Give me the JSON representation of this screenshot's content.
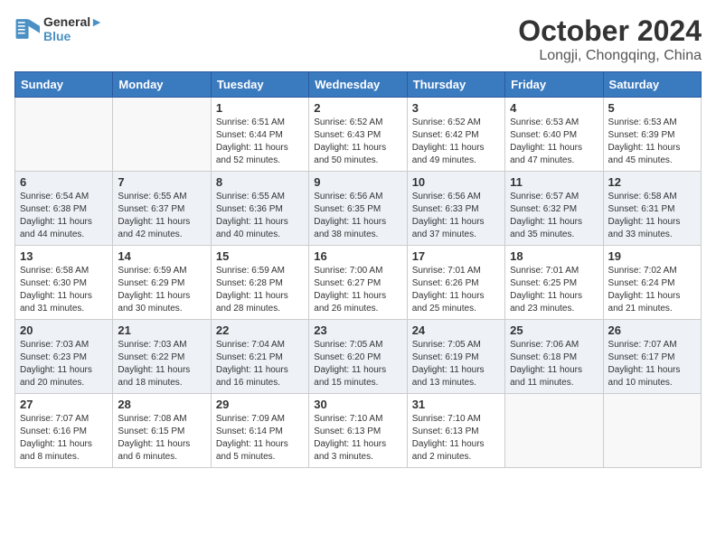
{
  "logo": {
    "line1": "General",
    "line2": "Blue"
  },
  "title": "October 2024",
  "location": "Longji, Chongqing, China",
  "weekdays": [
    "Sunday",
    "Monday",
    "Tuesday",
    "Wednesday",
    "Thursday",
    "Friday",
    "Saturday"
  ],
  "weeks": [
    [
      {
        "num": "",
        "sunrise": "",
        "sunset": "",
        "daylight": ""
      },
      {
        "num": "",
        "sunrise": "",
        "sunset": "",
        "daylight": ""
      },
      {
        "num": "1",
        "sunrise": "Sunrise: 6:51 AM",
        "sunset": "Sunset: 6:44 PM",
        "daylight": "Daylight: 11 hours and 52 minutes."
      },
      {
        "num": "2",
        "sunrise": "Sunrise: 6:52 AM",
        "sunset": "Sunset: 6:43 PM",
        "daylight": "Daylight: 11 hours and 50 minutes."
      },
      {
        "num": "3",
        "sunrise": "Sunrise: 6:52 AM",
        "sunset": "Sunset: 6:42 PM",
        "daylight": "Daylight: 11 hours and 49 minutes."
      },
      {
        "num": "4",
        "sunrise": "Sunrise: 6:53 AM",
        "sunset": "Sunset: 6:40 PM",
        "daylight": "Daylight: 11 hours and 47 minutes."
      },
      {
        "num": "5",
        "sunrise": "Sunrise: 6:53 AM",
        "sunset": "Sunset: 6:39 PM",
        "daylight": "Daylight: 11 hours and 45 minutes."
      }
    ],
    [
      {
        "num": "6",
        "sunrise": "Sunrise: 6:54 AM",
        "sunset": "Sunset: 6:38 PM",
        "daylight": "Daylight: 11 hours and 44 minutes."
      },
      {
        "num": "7",
        "sunrise": "Sunrise: 6:55 AM",
        "sunset": "Sunset: 6:37 PM",
        "daylight": "Daylight: 11 hours and 42 minutes."
      },
      {
        "num": "8",
        "sunrise": "Sunrise: 6:55 AM",
        "sunset": "Sunset: 6:36 PM",
        "daylight": "Daylight: 11 hours and 40 minutes."
      },
      {
        "num": "9",
        "sunrise": "Sunrise: 6:56 AM",
        "sunset": "Sunset: 6:35 PM",
        "daylight": "Daylight: 11 hours and 38 minutes."
      },
      {
        "num": "10",
        "sunrise": "Sunrise: 6:56 AM",
        "sunset": "Sunset: 6:33 PM",
        "daylight": "Daylight: 11 hours and 37 minutes."
      },
      {
        "num": "11",
        "sunrise": "Sunrise: 6:57 AM",
        "sunset": "Sunset: 6:32 PM",
        "daylight": "Daylight: 11 hours and 35 minutes."
      },
      {
        "num": "12",
        "sunrise": "Sunrise: 6:58 AM",
        "sunset": "Sunset: 6:31 PM",
        "daylight": "Daylight: 11 hours and 33 minutes."
      }
    ],
    [
      {
        "num": "13",
        "sunrise": "Sunrise: 6:58 AM",
        "sunset": "Sunset: 6:30 PM",
        "daylight": "Daylight: 11 hours and 31 minutes."
      },
      {
        "num": "14",
        "sunrise": "Sunrise: 6:59 AM",
        "sunset": "Sunset: 6:29 PM",
        "daylight": "Daylight: 11 hours and 30 minutes."
      },
      {
        "num": "15",
        "sunrise": "Sunrise: 6:59 AM",
        "sunset": "Sunset: 6:28 PM",
        "daylight": "Daylight: 11 hours and 28 minutes."
      },
      {
        "num": "16",
        "sunrise": "Sunrise: 7:00 AM",
        "sunset": "Sunset: 6:27 PM",
        "daylight": "Daylight: 11 hours and 26 minutes."
      },
      {
        "num": "17",
        "sunrise": "Sunrise: 7:01 AM",
        "sunset": "Sunset: 6:26 PM",
        "daylight": "Daylight: 11 hours and 25 minutes."
      },
      {
        "num": "18",
        "sunrise": "Sunrise: 7:01 AM",
        "sunset": "Sunset: 6:25 PM",
        "daylight": "Daylight: 11 hours and 23 minutes."
      },
      {
        "num": "19",
        "sunrise": "Sunrise: 7:02 AM",
        "sunset": "Sunset: 6:24 PM",
        "daylight": "Daylight: 11 hours and 21 minutes."
      }
    ],
    [
      {
        "num": "20",
        "sunrise": "Sunrise: 7:03 AM",
        "sunset": "Sunset: 6:23 PM",
        "daylight": "Daylight: 11 hours and 20 minutes."
      },
      {
        "num": "21",
        "sunrise": "Sunrise: 7:03 AM",
        "sunset": "Sunset: 6:22 PM",
        "daylight": "Daylight: 11 hours and 18 minutes."
      },
      {
        "num": "22",
        "sunrise": "Sunrise: 7:04 AM",
        "sunset": "Sunset: 6:21 PM",
        "daylight": "Daylight: 11 hours and 16 minutes."
      },
      {
        "num": "23",
        "sunrise": "Sunrise: 7:05 AM",
        "sunset": "Sunset: 6:20 PM",
        "daylight": "Daylight: 11 hours and 15 minutes."
      },
      {
        "num": "24",
        "sunrise": "Sunrise: 7:05 AM",
        "sunset": "Sunset: 6:19 PM",
        "daylight": "Daylight: 11 hours and 13 minutes."
      },
      {
        "num": "25",
        "sunrise": "Sunrise: 7:06 AM",
        "sunset": "Sunset: 6:18 PM",
        "daylight": "Daylight: 11 hours and 11 minutes."
      },
      {
        "num": "26",
        "sunrise": "Sunrise: 7:07 AM",
        "sunset": "Sunset: 6:17 PM",
        "daylight": "Daylight: 11 hours and 10 minutes."
      }
    ],
    [
      {
        "num": "27",
        "sunrise": "Sunrise: 7:07 AM",
        "sunset": "Sunset: 6:16 PM",
        "daylight": "Daylight: 11 hours and 8 minutes."
      },
      {
        "num": "28",
        "sunrise": "Sunrise: 7:08 AM",
        "sunset": "Sunset: 6:15 PM",
        "daylight": "Daylight: 11 hours and 6 minutes."
      },
      {
        "num": "29",
        "sunrise": "Sunrise: 7:09 AM",
        "sunset": "Sunset: 6:14 PM",
        "daylight": "Daylight: 11 hours and 5 minutes."
      },
      {
        "num": "30",
        "sunrise": "Sunrise: 7:10 AM",
        "sunset": "Sunset: 6:13 PM",
        "daylight": "Daylight: 11 hours and 3 minutes."
      },
      {
        "num": "31",
        "sunrise": "Sunrise: 7:10 AM",
        "sunset": "Sunset: 6:13 PM",
        "daylight": "Daylight: 11 hours and 2 minutes."
      },
      {
        "num": "",
        "sunrise": "",
        "sunset": "",
        "daylight": ""
      },
      {
        "num": "",
        "sunrise": "",
        "sunset": "",
        "daylight": ""
      }
    ]
  ]
}
